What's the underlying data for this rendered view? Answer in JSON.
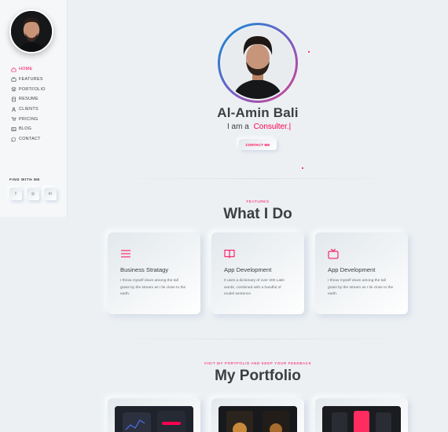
{
  "sidebar": {
    "nav": [
      {
        "label": "HOME",
        "icon": "home-icon",
        "active": true
      },
      {
        "label": "FEATURES",
        "icon": "features-icon"
      },
      {
        "label": "PORTFOLIO",
        "icon": "portfolio-icon"
      },
      {
        "label": "RESUME",
        "icon": "resume-icon"
      },
      {
        "label": "CLIENTS",
        "icon": "clients-icon"
      },
      {
        "label": "PRICING",
        "icon": "pricing-icon"
      },
      {
        "label": "BLOG",
        "icon": "blog-icon"
      },
      {
        "label": "CONTACT",
        "icon": "contact-icon"
      }
    ],
    "find_title": "FIND WITH ME",
    "socials": [
      {
        "icon": "facebook-icon",
        "glyph": "f"
      },
      {
        "icon": "instagram-icon",
        "glyph": "◎"
      },
      {
        "icon": "linkedin-icon",
        "glyph": "in"
      }
    ]
  },
  "hero": {
    "name": "Al-Amin Bali",
    "role_prefix": "I am a",
    "role_typed": "Consulter.",
    "cursor": "|",
    "contact_label": "CONTACT ME"
  },
  "features": {
    "subtitle": "FEATURES",
    "title": "What I Do",
    "cards": [
      {
        "icon": "menu-icon",
        "title": "Business Stratagy",
        "desc": "I throw myself down among the tall grass by the stream as I lie close to the earth."
      },
      {
        "icon": "book-icon",
        "title": "App Development",
        "desc": "It uses a dictionary of over 200 Latin words, combined with a handful of model sentence."
      },
      {
        "icon": "tv-icon",
        "title": "App Development",
        "desc": "I throw myself down among the tall grass by the stream as I lie close to the earth."
      }
    ]
  },
  "portfolio": {
    "subtitle": "VISIT MY PORTFOLIO AND KEEP YOUR FEEDBACK",
    "title": "My Portfolio"
  },
  "colors": {
    "accent": "#ff014f",
    "background": "#ecf0f3",
    "text": "#3c3e41"
  }
}
